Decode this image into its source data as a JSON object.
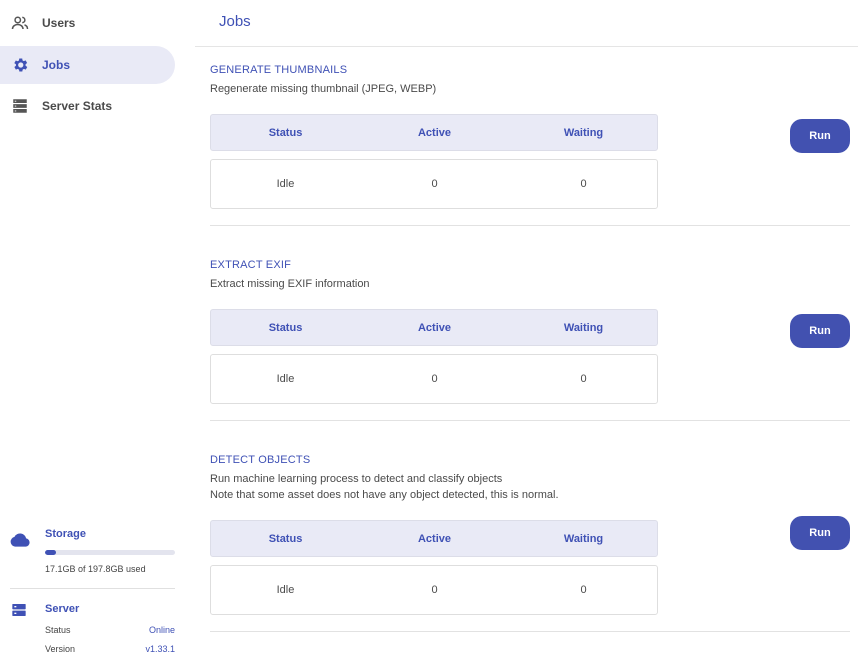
{
  "sidebar": {
    "items": [
      {
        "label": "Users",
        "icon": "users-icon",
        "active": false
      },
      {
        "label": "Jobs",
        "icon": "gear-icon",
        "active": true
      },
      {
        "label": "Server Stats",
        "icon": "server-stats-icon",
        "active": false
      }
    ],
    "storage": {
      "title": "Storage",
      "usage_text": "17.1GB of 197.8GB used",
      "used_fraction": 0.0865
    },
    "server": {
      "title": "Server",
      "status_label": "Status",
      "status_value": "Online",
      "version_label": "Version",
      "version_value": "v1.33.1"
    }
  },
  "main": {
    "title": "Jobs",
    "columns": [
      "Status",
      "Active",
      "Waiting"
    ],
    "jobs": [
      {
        "title": "GENERATE THUMBNAILS",
        "description": [
          "Regenerate missing thumbnail (JPEG, WEBP)"
        ],
        "status": "Idle",
        "active": "0",
        "waiting": "0",
        "button": "Run"
      },
      {
        "title": "EXTRACT EXIF",
        "description": [
          "Extract missing EXIF information"
        ],
        "status": "Idle",
        "active": "0",
        "waiting": "0",
        "button": "Run"
      },
      {
        "title": "DETECT OBJECTS",
        "description": [
          "Run machine learning process to detect and classify objects",
          "Note that some asset does not have any object detected, this is normal."
        ],
        "status": "Idle",
        "active": "0",
        "waiting": "0",
        "button": "Run"
      }
    ]
  },
  "colors": {
    "accent": "#3f51b5",
    "button": "#4251b0",
    "active_nav_bg": "#e9eaf6",
    "table_header_bg": "#e9eaf6"
  }
}
